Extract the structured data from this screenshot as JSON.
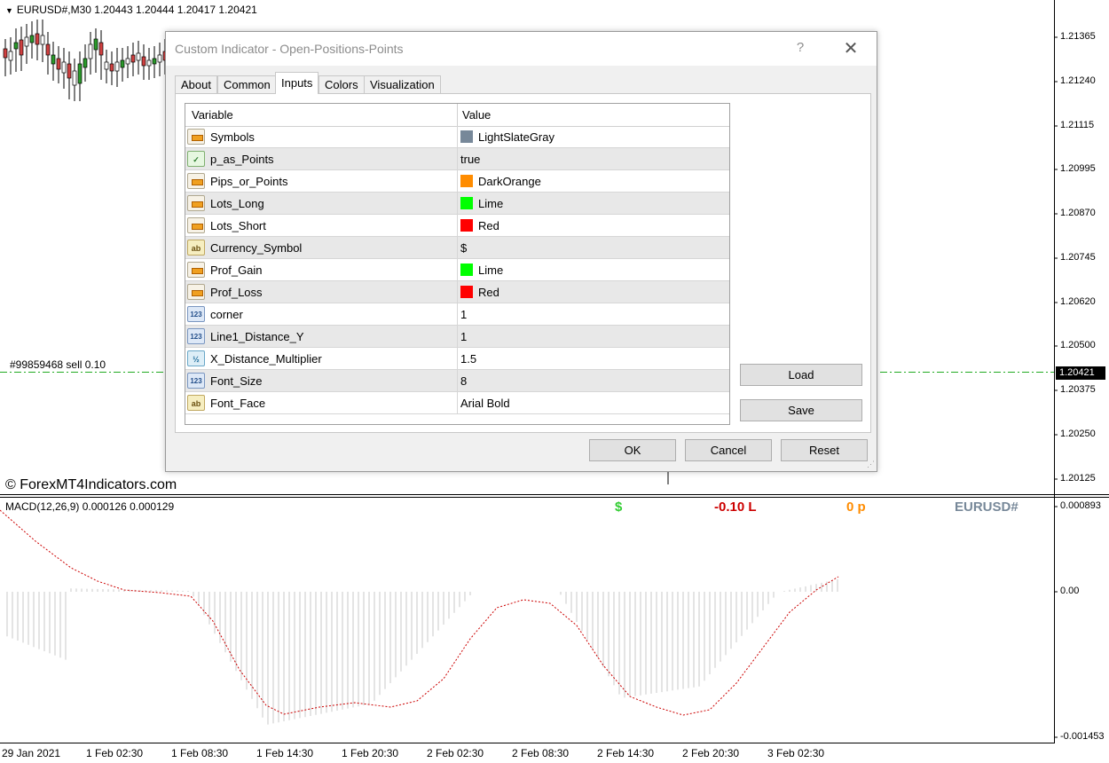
{
  "chart": {
    "symbol_info": "EURUSD#,M30  1.20443 1.20444 1.20417 1.20421",
    "order_label": "#99859468 sell 0.10",
    "copyright": "© ForexMT4Indicators.com",
    "macd_label": "MACD(12,26,9) 0.000126 0.000129",
    "overlay": {
      "currency": {
        "text": "$",
        "color": "#32cd32"
      },
      "lots": {
        "text": "-0.10 L",
        "color": "#cc0000"
      },
      "points": {
        "text": "0 p",
        "color": "#ff8c00"
      },
      "symbol": {
        "text": "EURUSD#",
        "color": "#778899"
      }
    },
    "price_ticks": [
      "1.21365",
      "1.21240",
      "1.21115",
      "1.20995",
      "1.20870",
      "1.20745",
      "1.20620",
      "1.20500",
      "1.20375",
      "1.20250",
      "1.20125"
    ],
    "current_price": "1.20421",
    "macd_ticks": [
      "0.000893",
      "0.00",
      "-0.001453"
    ],
    "time_ticks": [
      "29 Jan 2021",
      "1 Feb 02:30",
      "1 Feb 08:30",
      "1 Feb 14:30",
      "1 Feb 20:30",
      "2 Feb 02:30",
      "2 Feb 08:30",
      "2 Feb 14:30",
      "2 Feb 20:30",
      "3 Feb 02:30"
    ]
  },
  "dialog": {
    "title": "Custom Indicator - Open-Positions-Points",
    "help": "?",
    "close": "✕",
    "tabs": [
      "About",
      "Common",
      "Inputs",
      "Colors",
      "Visualization"
    ],
    "active_tab": "Inputs",
    "columns": {
      "variable": "Variable",
      "value": "Value"
    },
    "rows": [
      {
        "name": "Symbols",
        "value": "LightSlateGray",
        "type": "color",
        "swatch": "#778899"
      },
      {
        "name": "p_as_Points",
        "value": "true",
        "type": "bool"
      },
      {
        "name": "Pips_or_Points",
        "value": "DarkOrange",
        "type": "color",
        "swatch": "#ff8c00"
      },
      {
        "name": "Lots_Long",
        "value": "Lime",
        "type": "color",
        "swatch": "#00ff00"
      },
      {
        "name": "Lots_Short",
        "value": "Red",
        "type": "color",
        "swatch": "#ff0000"
      },
      {
        "name": "Currency_Symbol",
        "value": "$",
        "type": "string"
      },
      {
        "name": "Prof_Gain",
        "value": "Lime",
        "type": "color",
        "swatch": "#00ff00"
      },
      {
        "name": "Prof_Loss",
        "value": "Red",
        "type": "color",
        "swatch": "#ff0000"
      },
      {
        "name": "corner",
        "value": "1",
        "type": "int"
      },
      {
        "name": "Line1_Distance_Y",
        "value": "1",
        "type": "int"
      },
      {
        "name": "X_Distance_Multiplier",
        "value": "1.5",
        "type": "double"
      },
      {
        "name": "Font_Size",
        "value": "8",
        "type": "int"
      },
      {
        "name": "Font_Face",
        "value": "Arial Bold",
        "type": "string"
      }
    ],
    "icon_glyphs": {
      "string": "ab",
      "int": "123",
      "double": "½",
      "bool": "✓"
    },
    "buttons": {
      "load": "Load",
      "save": "Save",
      "ok": "OK",
      "cancel": "Cancel",
      "reset": "Reset"
    }
  }
}
